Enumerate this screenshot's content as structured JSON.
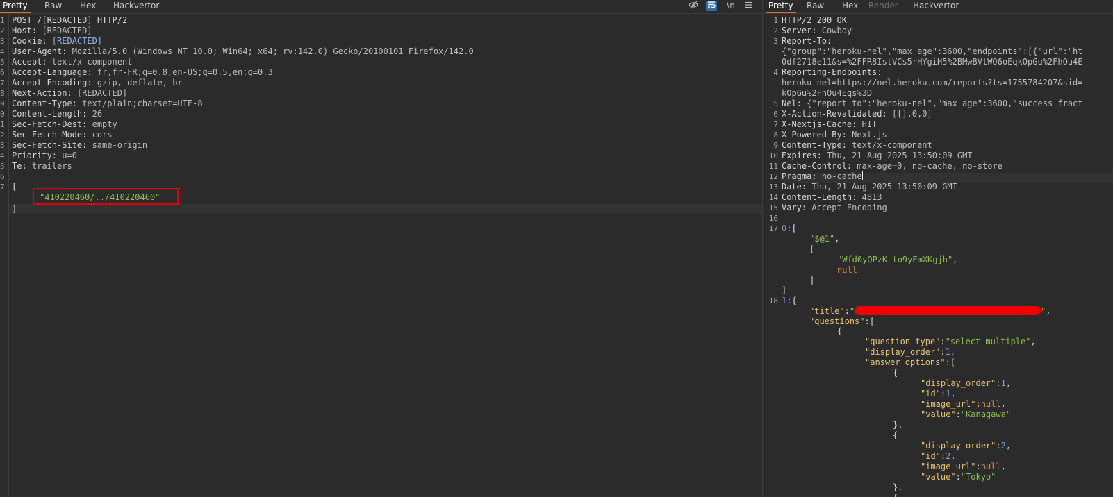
{
  "request": {
    "tabs": [
      "Pretty",
      "Raw",
      "Hex",
      "Hackvertor"
    ],
    "active_tab": "Pretty",
    "tools": {
      "hide_icon": "eye-slash-icon",
      "wrap_icon": "wrap-icon",
      "newline_label": "\\n",
      "menu_icon": "menu-icon"
    },
    "line_numbers": [
      "1",
      "2",
      "3",
      "4",
      "5",
      "6",
      "7",
      "8",
      "9",
      "0",
      "1",
      "2",
      "3",
      "4",
      "5",
      "6",
      "7"
    ],
    "request_line": "POST /[REDACTED] HTTP/2",
    "headers": [
      {
        "k": "Host:",
        "v": " [REDACTED]"
      },
      {
        "k": "Cookie:",
        "v": " [REDACTED]"
      },
      {
        "k": "User-Agent:",
        "v": " Mozilla/5.0 (Windows NT 10.0; Win64; x64; rv:142.0) Gecko/20100101 Firefox/142.0"
      },
      {
        "k": "Accept:",
        "v": " text/x-component"
      },
      {
        "k": "Accept-Language:",
        "v": " fr,fr-FR;q=0.8,en-US;q=0.5,en;q=0.3"
      },
      {
        "k": "Accept-Encoding:",
        "v": " gzip, deflate, br"
      },
      {
        "k": "Next-Action:",
        "v": " [REDACTED]"
      },
      {
        "k": "Content-Type:",
        "v": " text/plain;charset=UTF-8"
      },
      {
        "k": "Content-Length:",
        "v": " 26"
      },
      {
        "k": "Sec-Fetch-Dest:",
        "v": " empty"
      },
      {
        "k": "Sec-Fetch-Mode:",
        "v": " cors"
      },
      {
        "k": "Sec-Fetch-Site:",
        "v": " same-origin"
      },
      {
        "k": "Priority:",
        "v": " u=0"
      },
      {
        "k": "Te:",
        "v": " trailers"
      }
    ],
    "body_open": "[",
    "body_value": "\"410220460/../410220460\"",
    "body_close": "]"
  },
  "response": {
    "tabs": [
      "Pretty",
      "Raw",
      "Hex",
      "Render",
      "Hackvertor"
    ],
    "active_tab": "Pretty",
    "status_line": "HTTP/2 200 OK",
    "headers": [
      {
        "n": "2",
        "k": "Server:",
        "v": " Cowboy"
      },
      {
        "n": "3",
        "k": "Report-To:",
        "v": ""
      },
      {
        "n": "",
        "k": "",
        "v": "{\"group\":\"heroku-nel\",\"max_age\":3600,\"endpoints\":[{\"url\":\"ht"
      },
      {
        "n": "",
        "k": "",
        "v": "0df2718e11&s=%2FFR8IstVCs5rHYgiH5%2BMwBVtWQ6oEqkOpGu%2FhOu4E"
      },
      {
        "n": "4",
        "k": "Reporting-Endpoints:",
        "v": ""
      },
      {
        "n": "",
        "k": "",
        "v": "heroku-nel=https://nel.heroku.com/reports?ts=1755784207&sid="
      },
      {
        "n": "",
        "k": "",
        "v": "kOpGu%2FhOu4Eqs%3D"
      },
      {
        "n": "5",
        "k": "Nel:",
        "v": " {\"report_to\":\"heroku-nel\",\"max_age\":3600,\"success_fract"
      },
      {
        "n": "6",
        "k": "X-Action-Revalidated:",
        "v": " [[],0,0]"
      },
      {
        "n": "7",
        "k": "X-Nextjs-Cache:",
        "v": " HIT"
      },
      {
        "n": "8",
        "k": "X-Powered-By:",
        "v": " Next.js"
      },
      {
        "n": "9",
        "k": "Content-Type:",
        "v": " text/x-component"
      },
      {
        "n": "10",
        "k": "Expires:",
        "v": " Thu, 21 Aug 2025 13:50:09 GMT"
      },
      {
        "n": "11",
        "k": "Cache-Control:",
        "v": " max-age=0, no-cache, no-store"
      },
      {
        "n": "12",
        "k": "Pragma:",
        "v": " no-cache"
      },
      {
        "n": "13",
        "k": "Date:",
        "v": " Thu, 21 Aug 2025 13:50:09 GMT"
      },
      {
        "n": "14",
        "k": "Content-Length:",
        "v": " 4813"
      },
      {
        "n": "15",
        "k": "Vary:",
        "v": " Accept-Encoding"
      }
    ],
    "line_16": "16",
    "line_17": "17",
    "line_18": "18",
    "body": {
      "row0_key": "0",
      "row0_val": "\"$@1\"",
      "row0_id": "\"Wfd0yQPzK_to9yEmXKgjh\"",
      "null": "null",
      "row1_key": "1",
      "title_key": "\"title\"",
      "questions_key": "\"questions\"",
      "question_type_key": "\"question_type\"",
      "question_type_val": "\"select_multiple\"",
      "display_order_key": "\"display_order\"",
      "display_order_val": "1",
      "answer_options_key": "\"answer_options\"",
      "id_key": "\"id\"",
      "image_url_key": "\"image_url\"",
      "value_key": "\"value\"",
      "options": [
        {
          "display_order": "1",
          "id": "1",
          "value": "\"Kanagawa\""
        },
        {
          "display_order": "2",
          "id": "2",
          "value": "\"Tokyo\""
        }
      ]
    }
  },
  "colors": {
    "accent": "#e46a2b",
    "key": "#e9c46a",
    "string": "#8fbf4b",
    "number": "#6fa8dc",
    "null": "#e08a2c",
    "highlight_box": "#e20000"
  }
}
